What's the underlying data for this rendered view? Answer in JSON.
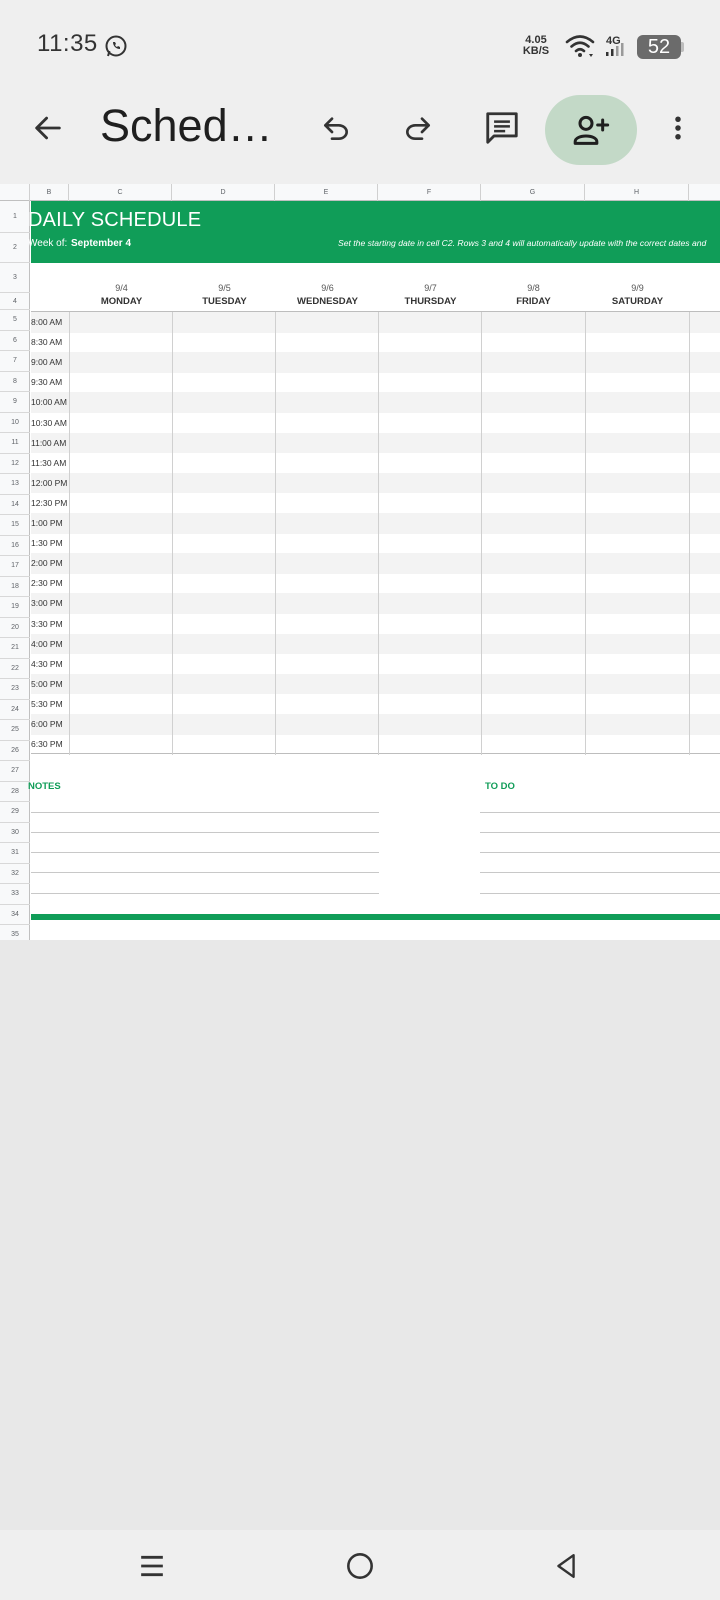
{
  "status_bar": {
    "time": "11:35",
    "speed_value": "4.05",
    "speed_unit": "KB/S",
    "network": "4G",
    "battery": "52"
  },
  "toolbar": {
    "title": "Sched…",
    "icons": [
      "back-arrow-icon",
      "undo-icon",
      "redo-icon",
      "comment-icon",
      "add-person-icon",
      "more-vert-icon"
    ]
  },
  "sheet": {
    "columns": [
      "B",
      "C",
      "D",
      "E",
      "F",
      "G",
      "H"
    ],
    "rows": [
      "1",
      "2",
      "3",
      "4",
      "5",
      "6",
      "7",
      "8",
      "9",
      "10",
      "11",
      "12",
      "13",
      "14",
      "15",
      "16",
      "17",
      "18",
      "19",
      "20",
      "21",
      "22",
      "23",
      "24",
      "25",
      "26",
      "27",
      "28",
      "29",
      "30",
      "31",
      "32",
      "33",
      "34",
      "35"
    ],
    "banner": {
      "title": "DAILY SCHEDULE",
      "week_label": "Week of:",
      "week_value": "September 4",
      "note": "Set the starting date in cell C2. Rows 3 and 4 will automatically update with the correct dates and"
    },
    "days": [
      {
        "date": "9/4",
        "name": "MONDAY"
      },
      {
        "date": "9/5",
        "name": "TUESDAY"
      },
      {
        "date": "9/6",
        "name": "WEDNESDAY"
      },
      {
        "date": "9/7",
        "name": "THURSDAY"
      },
      {
        "date": "9/8",
        "name": "FRIDAY"
      },
      {
        "date": "9/9",
        "name": "SATURDAY"
      }
    ],
    "times": [
      "8:00 AM",
      "8:30 AM",
      "9:00 AM",
      "9:30 AM",
      "10:00 AM",
      "10:30 AM",
      "11:00 AM",
      "11:30 AM",
      "12:00 PM",
      "12:30 PM",
      "1:00 PM",
      "1:30 PM",
      "2:00 PM",
      "2:30 PM",
      "3:00 PM",
      "3:30 PM",
      "4:00 PM",
      "4:30 PM",
      "5:00 PM",
      "5:30 PM",
      "6:00 PM",
      "6:30 PM"
    ],
    "notes_label": "NOTES",
    "todo_label": "TO DO"
  },
  "colors": {
    "accent": "#109d58",
    "share_bg": "#c3d9c7"
  }
}
